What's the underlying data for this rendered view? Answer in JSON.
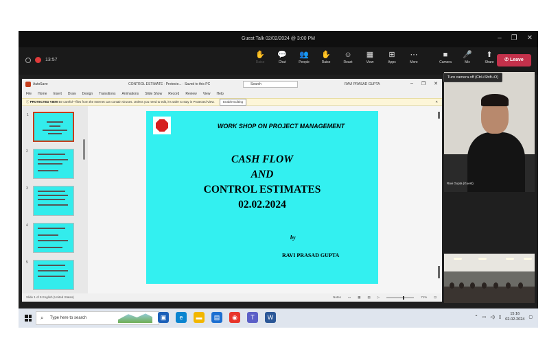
{
  "teams": {
    "meeting_title": "Guest Talk 02/02/2024 @ 3:00 PM",
    "timer": "13:57",
    "tools": [
      {
        "label": "Raise",
        "icon": "✋",
        "dim": true
      },
      {
        "label": "Chat",
        "icon": "💬",
        "dim": false
      },
      {
        "label": "People",
        "icon": "👥",
        "dim": false
      },
      {
        "label": "Raise",
        "icon": "✋",
        "dim": false
      },
      {
        "label": "React",
        "icon": "☺",
        "dim": false
      },
      {
        "label": "View",
        "icon": "▦",
        "dim": false
      },
      {
        "label": "Apps",
        "icon": "⊞",
        "dim": false
      },
      {
        "label": "More",
        "icon": "⋯",
        "dim": false
      },
      {
        "label": "Camera",
        "icon": "■",
        "dim": false
      },
      {
        "label": "Mic",
        "icon": "🎤",
        "dim": false
      },
      {
        "label": "Share",
        "icon": "⬆",
        "dim": false
      }
    ],
    "leave_label": "Leave",
    "tooltip": "Turn camera off (Ctrl+Shift+O)",
    "participant_name": "Ravi Gupta (Guest)"
  },
  "ppt": {
    "autosave": "AutoSave",
    "filename": "CONTROL ESTIMATE · Protecte... · Saved to this PC",
    "search_placeholder": "Search",
    "user": "RAVI PRASAD GUPTA",
    "menu": [
      "File",
      "Home",
      "Insert",
      "Draw",
      "Design",
      "Transitions",
      "Animations",
      "Slide Show",
      "Record",
      "Review",
      "View",
      "Help"
    ],
    "protected_label": "PROTECTED VIEW",
    "protected_text": "Be careful—files from the Internet can contain viruses. Unless you need to edit, it's safer to stay in Protected View.",
    "enable_editing": "Enable Editing",
    "status_left": "Slide 1 of 9   English (United States)",
    "status_notes": "Notes",
    "zoom": "71%"
  },
  "slide": {
    "heading": "WORK SHOP ON PROJECT MANAGEMENT",
    "line1": "CASH FLOW",
    "line2": "AND",
    "line3": "CONTROL ESTIMATES",
    "date": "02.02.2024",
    "by": "by",
    "author": "RAVI PRASAD GUPTA"
  },
  "taskbar": {
    "search_placeholder": "Type here to search",
    "time": "15:16",
    "date": "02-02-2024"
  }
}
